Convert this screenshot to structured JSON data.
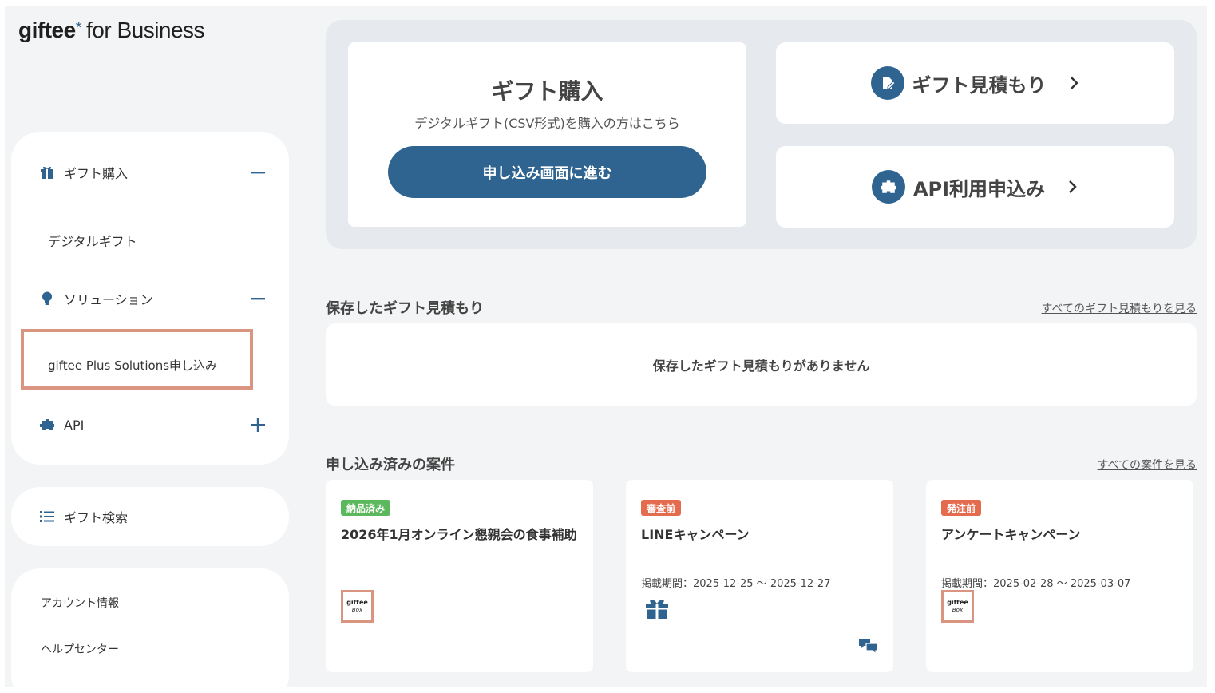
{
  "logo": {
    "brand": "giftee",
    "star": "*",
    "rest": "for Business"
  },
  "sidebar": {
    "gift_purchase": {
      "label": "ギフト購入",
      "icon": "gift-icon",
      "toggle": "minus"
    },
    "digital_gift": "デジタルギフト",
    "solutions": {
      "label": "ソリューション",
      "icon": "lightbulb-icon",
      "toggle": "minus"
    },
    "giftee_plus": "giftee Plus Solutions申し込み",
    "api": {
      "label": "API",
      "icon": "puzzle-icon",
      "toggle": "plus"
    },
    "gift_search": {
      "label": "ギフト検索",
      "icon": "list-icon"
    },
    "account_info": "アカウント情報",
    "help_center": "ヘルプセンター"
  },
  "hero": {
    "purchase_title": "ギフト購入",
    "purchase_sub": "デジタルギフト(CSV形式)を購入の方はこちら",
    "purchase_button": "申し込み画面に進む",
    "estimate_link": "ギフト見積もり",
    "api_link": "API利用申込み"
  },
  "saved_estimates": {
    "title": "保存したギフト見積もり",
    "see_all": "すべてのギフト見積もりを見る",
    "empty": "保存したギフト見積もりがありません"
  },
  "cases": {
    "title": "申し込み済みの案件",
    "see_all": "すべての案件を見る",
    "items": [
      {
        "status": "納品済み",
        "status_color": "#5cb85c",
        "title": "2026年1月オンライン懇親会の食事補助",
        "period": "",
        "thumb": "giftee-box"
      },
      {
        "status": "審査前",
        "status_color": "#e56b4f",
        "title": "LINEキャンペーン",
        "period": "掲載期間：2025-12-25 〜 2025-12-27",
        "thumb": "gift-icon"
      },
      {
        "status": "発注前",
        "status_color": "#e56b4f",
        "title": "アンケートキャンペーン",
        "period": "掲載期間：2025-02-28 〜 2025-03-07",
        "thumb": "giftee-box"
      }
    ],
    "giftee_box_line1": "giftee",
    "giftee_box_line2": "Box"
  },
  "colors": {
    "primary": "#2f6490",
    "highlight": "#d99482",
    "background": "#f3f4f6"
  }
}
